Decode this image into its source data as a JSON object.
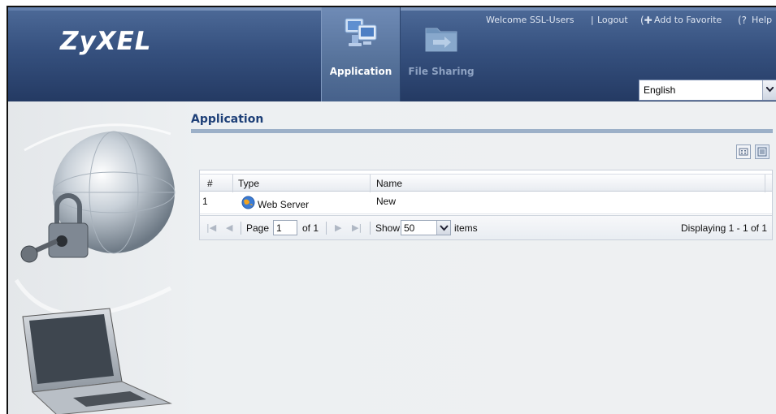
{
  "brand": {
    "logo": "ZyXEL"
  },
  "tabs": [
    {
      "label": "Application",
      "active": true,
      "icon": "monitor-network-icon"
    },
    {
      "label": "File Sharing",
      "active": false,
      "icon": "folder-share-icon"
    }
  ],
  "topbar": {
    "welcome": "Welcome SSL-Users",
    "separator": "|",
    "logout": "Logout",
    "add_favorite": "Add to Favorite",
    "help": "Help"
  },
  "language": {
    "selected": "English"
  },
  "section": {
    "title": "Application"
  },
  "table": {
    "columns": [
      "#",
      "Type",
      "Name"
    ],
    "rows": [
      {
        "num": "1",
        "type": "Web Server",
        "name": "New",
        "type_icon": "globe-icon"
      }
    ]
  },
  "pager": {
    "page_label": "Page",
    "page_value": "1",
    "of_label": "of 1",
    "show_label": "Show",
    "show_value": "50",
    "items_label": "items",
    "displaying": "Displaying 1 - 1 of 1"
  },
  "colors": {
    "header_dark": "#243a63",
    "header_mid": "#36517f",
    "title_blue": "#1d3f77",
    "section_bar": "#9cb0c8"
  }
}
